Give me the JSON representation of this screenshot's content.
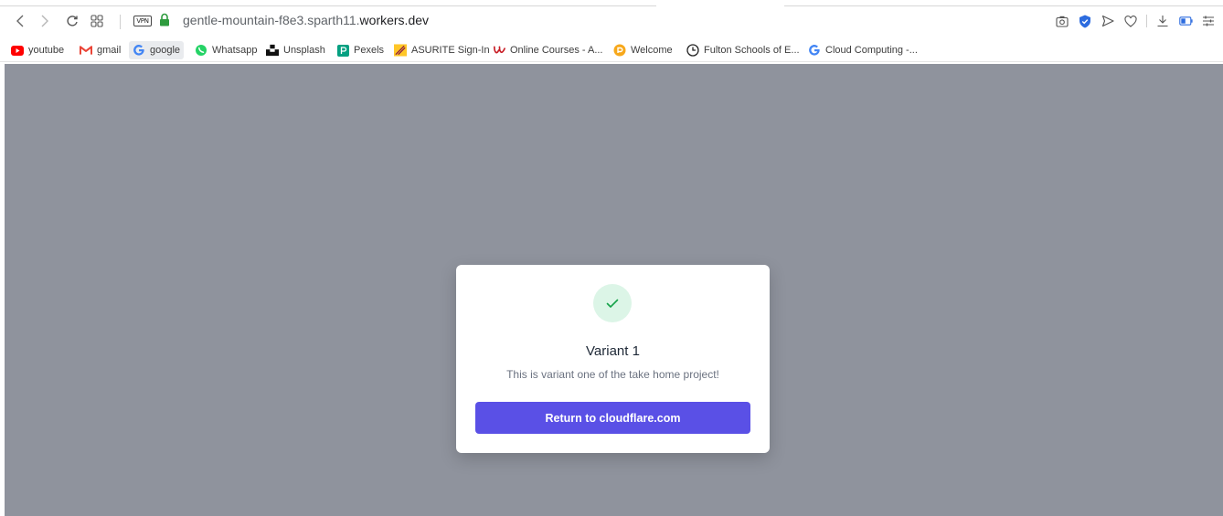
{
  "browser": {
    "url_prefix": "gentle-mountain-f8e3.sparth11.",
    "url_domain": "workers.dev",
    "vpn_label": "VPN",
    "lock_color": "#2e9b3e"
  },
  "bookmarks": [
    {
      "label": "youtube",
      "icon": "youtube-icon"
    },
    {
      "label": "gmail",
      "icon": "gmail-icon"
    },
    {
      "label": "google",
      "icon": "google-icon"
    },
    {
      "label": "Whatsapp",
      "icon": "whatsapp-icon"
    },
    {
      "label": "Unsplash",
      "icon": "unsplash-icon"
    },
    {
      "label": "Pexels",
      "icon": "pexels-icon"
    },
    {
      "label": "ASURITE Sign-In",
      "icon": "asurite-icon"
    },
    {
      "label": "Online Courses - A...",
      "icon": "courses-icon"
    },
    {
      "label": "Welcome",
      "icon": "welcome-icon"
    },
    {
      "label": "Fulton Schools of E...",
      "icon": "fulton-icon"
    },
    {
      "label": "Cloud Computing -...",
      "icon": "google-icon"
    }
  ],
  "modal": {
    "title": "Variant 1",
    "description": "This is variant one of the take home project!",
    "button_label": "Return to cloudflare.com",
    "accent_color": "#5a50e6",
    "success_color": "#16a34a"
  }
}
